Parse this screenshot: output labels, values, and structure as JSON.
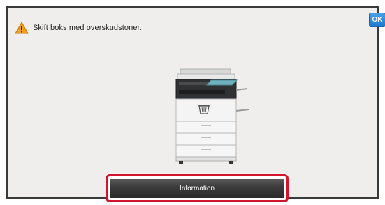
{
  "message": {
    "icon": "warning-triangle-icon",
    "text": "Skift boks med overskudstoner."
  },
  "ok_button": {
    "label": "OK"
  },
  "illustration": {
    "icon": "printer-icon"
  },
  "info_button": {
    "label": "Information"
  },
  "colors": {
    "panel_bg": "#efeeec",
    "ok_blue": "#1f78cf",
    "warning_orange": "#f0a020",
    "highlight_red": "#d2142c",
    "button_dark": "#3a3a3a"
  }
}
